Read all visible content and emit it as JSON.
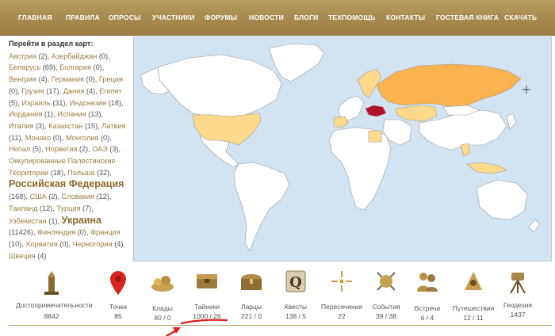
{
  "nav": {
    "items": [
      "ГЛАВНАЯ",
      "ПРАВИЛА",
      "ОПРОСЫ",
      "УЧАСТНИКИ",
      "ФОРУМЫ",
      "НОВОСТИ",
      "БЛОГИ",
      "ТЕХПОМОЩЬ",
      "КОНТАКТЫ",
      "ГОСТЕВАЯ КНИГА",
      "СКАЧАТЬ"
    ]
  },
  "sidebar": {
    "heading": "Перейти в раздел карт:",
    "countries": [
      {
        "name": "Австрия",
        "count": "(2)"
      },
      {
        "name": "Азербайджан",
        "count": "(0)"
      },
      {
        "name": "Беларусь",
        "count": "(69)"
      },
      {
        "name": "Болгария",
        "count": "(0)"
      },
      {
        "name": "Венгрия",
        "count": "(4)"
      },
      {
        "name": "Германия",
        "count": "(0)"
      },
      {
        "name": "Греция",
        "count": "(0)"
      },
      {
        "name": "Грузия",
        "count": "(17)"
      },
      {
        "name": "Дания",
        "count": "(4)"
      },
      {
        "name": "Египет",
        "count": "(5)"
      },
      {
        "name": "Израиль",
        "count": "(31)"
      },
      {
        "name": "Индонезия",
        "count": "(18)"
      },
      {
        "name": "Иордания",
        "count": "(1)"
      },
      {
        "name": "Испания",
        "count": "(13)"
      },
      {
        "name": "Италия",
        "count": "(3)"
      },
      {
        "name": "Казахстан",
        "count": "(15)"
      },
      {
        "name": "Латвия",
        "count": "(11)"
      },
      {
        "name": "Монако",
        "count": "(0)"
      },
      {
        "name": "Монголия",
        "count": "(0)"
      },
      {
        "name": "Непал",
        "count": "(5)"
      },
      {
        "name": "Норвегия",
        "count": "(2)"
      },
      {
        "name": "ОАЭ",
        "count": "(3)"
      },
      {
        "name": "Оккупированные Палестинские Территории",
        "count": "(18)"
      },
      {
        "name": "Польша",
        "count": "(32)"
      },
      {
        "name": "Российская Федерация",
        "count": "(168)"
      },
      {
        "name": "США",
        "count": "(2)"
      },
      {
        "name": "Словакия",
        "count": "(12)"
      },
      {
        "name": "Таиланд",
        "count": "(12)"
      },
      {
        "name": "Турция",
        "count": "(7)"
      },
      {
        "name": "Узбекистан",
        "count": "(1)"
      },
      {
        "name": "Украина",
        "count": "(11426)"
      },
      {
        "name": "Финляндия",
        "count": "(0)"
      },
      {
        "name": "Франция",
        "count": "(10)"
      },
      {
        "name": "Хорватия",
        "count": "(0)"
      },
      {
        "name": "Черногория",
        "count": "(4)"
      },
      {
        "name": "Швеция",
        "count": "(4)"
      }
    ]
  },
  "map": {
    "zoom_icon": "crosshair-icon",
    "colors": {
      "water": "#d2e3f1",
      "none": "#ffffff",
      "low": "#fdd98b",
      "mid": "#fbb350",
      "high": "#f79a2a",
      "top": "#b5102b"
    }
  },
  "stats": [
    {
      "icon": "monument-icon",
      "label": "Достопримечательности",
      "value": "8842"
    },
    {
      "icon": "map-pin-icon",
      "label": "Точки",
      "value": "85"
    },
    {
      "icon": "treasure-icon",
      "label": "Клады",
      "value": "80 / 0"
    },
    {
      "icon": "cache-box-icon",
      "label": "Тайники",
      "value": "1000 / 26"
    },
    {
      "icon": "chest-icon",
      "label": "Ларцы",
      "value": "221 / 0"
    },
    {
      "icon": "quest-icon",
      "label": "Квесты",
      "value": "138 / 5"
    },
    {
      "icon": "crossing-icon",
      "label": "Пересечения",
      "value": "22"
    },
    {
      "icon": "event-icon",
      "label": "События",
      "value": "39 / 38"
    },
    {
      "icon": "meeting-icon",
      "label": "Встречи",
      "value": "6 / 4"
    },
    {
      "icon": "travel-icon",
      "label": "Путешествия",
      "value": "12 / 11"
    },
    {
      "icon": "geodesy-icon",
      "label": "Геодезия",
      "value": "1437"
    }
  ]
}
